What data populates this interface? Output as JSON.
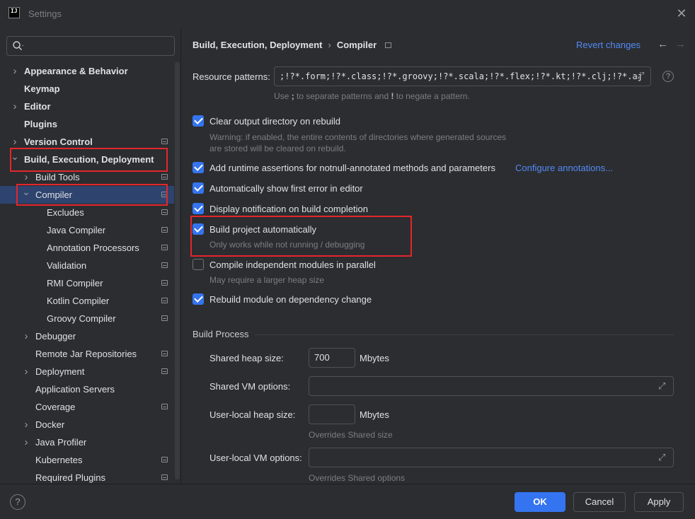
{
  "window": {
    "logo_text": "IJ",
    "title": "Settings"
  },
  "search": {
    "placeholder": "",
    "value": ""
  },
  "sidebar": {
    "items": [
      {
        "label": "Appearance & Behavior",
        "level": 0,
        "chevron": "right",
        "bold": true,
        "proj_icon": false
      },
      {
        "label": "Keymap",
        "level": 0,
        "chevron": "",
        "bold": true,
        "proj_icon": false
      },
      {
        "label": "Editor",
        "level": 0,
        "chevron": "right",
        "bold": true,
        "proj_icon": false
      },
      {
        "label": "Plugins",
        "level": 0,
        "chevron": "",
        "bold": true,
        "proj_icon": false
      },
      {
        "label": "Version Control",
        "level": 0,
        "chevron": "right",
        "bold": true,
        "proj_icon": true
      },
      {
        "label": "Build, Execution, Deployment",
        "level": 0,
        "chevron": "down",
        "bold": true,
        "proj_icon": false
      },
      {
        "label": "Build Tools",
        "level": 1,
        "chevron": "right",
        "bold": false,
        "proj_icon": true
      },
      {
        "label": "Compiler",
        "level": 1,
        "chevron": "down",
        "bold": false,
        "proj_icon": true,
        "selected": true
      },
      {
        "label": "Excludes",
        "level": 2,
        "chevron": "",
        "bold": false,
        "proj_icon": true
      },
      {
        "label": "Java Compiler",
        "level": 2,
        "chevron": "",
        "bold": false,
        "proj_icon": true
      },
      {
        "label": "Annotation Processors",
        "level": 2,
        "chevron": "",
        "bold": false,
        "proj_icon": true
      },
      {
        "label": "Validation",
        "level": 2,
        "chevron": "",
        "bold": false,
        "proj_icon": true
      },
      {
        "label": "RMI Compiler",
        "level": 2,
        "chevron": "",
        "bold": false,
        "proj_icon": true
      },
      {
        "label": "Kotlin Compiler",
        "level": 2,
        "chevron": "",
        "bold": false,
        "proj_icon": true
      },
      {
        "label": "Groovy Compiler",
        "level": 2,
        "chevron": "",
        "bold": false,
        "proj_icon": true
      },
      {
        "label": "Debugger",
        "level": 1,
        "chevron": "right",
        "bold": false,
        "proj_icon": false
      },
      {
        "label": "Remote Jar Repositories",
        "level": 1,
        "chevron": "",
        "bold": false,
        "proj_icon": true
      },
      {
        "label": "Deployment",
        "level": 1,
        "chevron": "right",
        "bold": false,
        "proj_icon": true
      },
      {
        "label": "Application Servers",
        "level": 1,
        "chevron": "",
        "bold": false,
        "proj_icon": false
      },
      {
        "label": "Coverage",
        "level": 1,
        "chevron": "",
        "bold": false,
        "proj_icon": true
      },
      {
        "label": "Docker",
        "level": 1,
        "chevron": "right",
        "bold": false,
        "proj_icon": false
      },
      {
        "label": "Java Profiler",
        "level": 1,
        "chevron": "right",
        "bold": false,
        "proj_icon": false
      },
      {
        "label": "Kubernetes",
        "level": 1,
        "chevron": "",
        "bold": false,
        "proj_icon": true
      },
      {
        "label": "Required Plugins",
        "level": 1,
        "chevron": "",
        "bold": false,
        "proj_icon": true
      }
    ]
  },
  "header": {
    "breadcrumb_parent": "Build, Execution, Deployment",
    "breadcrumb_separator": "›",
    "breadcrumb_current": "Compiler",
    "revert_label": "Revert changes",
    "back_icon": "←",
    "forward_icon": "→"
  },
  "resource": {
    "label": "Resource patterns:",
    "value": ";!?*.form;!?*.class;!?*.groovy;!?*.scala;!?*.flex;!?*.kt;!?*.clj;!?*.aj",
    "hint_pre": "Use ",
    "hint_semi": ";",
    "hint_mid": " to separate patterns and ",
    "hint_bang": "!",
    "hint_post": " to negate a pattern."
  },
  "options": {
    "clear_output": {
      "label": "Clear output directory on rebuild",
      "checked": true,
      "hint1": "Warning: if enabled, the entire contents of directories where generated sources",
      "hint2": "are stored will be cleared on rebuild."
    },
    "runtime_assertions": {
      "label": "Add runtime assertions for notnull-annotated methods and parameters",
      "checked": true,
      "link": "Configure annotations..."
    },
    "show_first_error": {
      "label": "Automatically show first error in editor",
      "checked": true
    },
    "notify_build": {
      "label": "Display notification on build completion",
      "checked": true
    },
    "build_auto": {
      "label": "Build project automatically",
      "checked": true,
      "hint": "Only works while not running / debugging"
    },
    "parallel": {
      "label": "Compile independent modules in parallel",
      "checked": false,
      "hint": "May require a larger heap size"
    },
    "rebuild_dep": {
      "label": "Rebuild module on dependency change",
      "checked": true
    }
  },
  "build_process": {
    "title": "Build Process",
    "shared_heap_label": "Shared heap size:",
    "shared_heap_value": "700",
    "shared_heap_unit": "Mbytes",
    "shared_vm_label": "Shared VM options:",
    "shared_vm_value": "",
    "user_heap_label": "User-local heap size:",
    "user_heap_value": "",
    "user_heap_unit": "Mbytes",
    "user_heap_hint": "Overrides Shared size",
    "user_vm_label": "User-local VM options:",
    "user_vm_value": "",
    "user_vm_hint": "Overrides Shared options"
  },
  "footer": {
    "help": "?",
    "ok": "OK",
    "cancel": "Cancel",
    "apply": "Apply"
  },
  "colors": {
    "background": "#2b2d30",
    "accent": "#3574f0",
    "link": "#548af7",
    "selection": "#2e436e",
    "highlight_box": "#e5262c"
  }
}
